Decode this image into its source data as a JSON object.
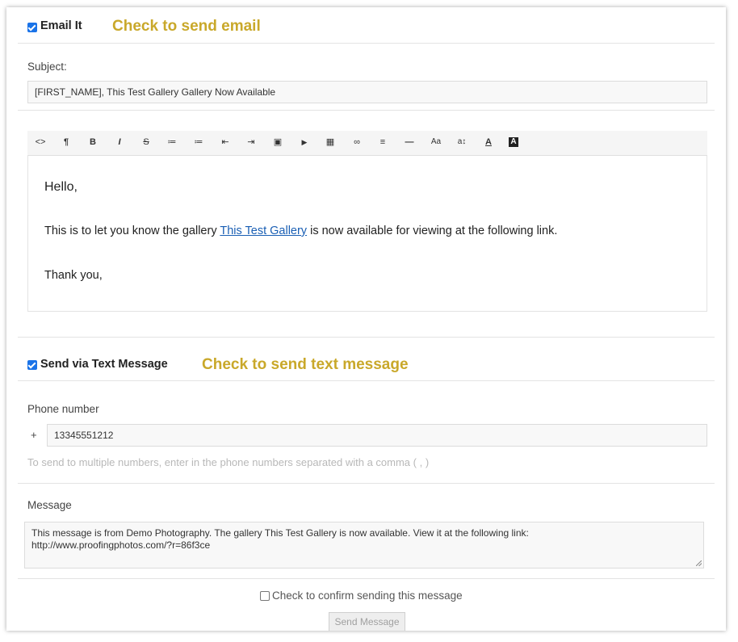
{
  "email": {
    "checkbox_label": "Email It",
    "checked": true,
    "hint": "Check to send email",
    "subject_label": "Subject:",
    "subject_value": "[FIRST_NAME], This Test Gallery Gallery Now Available",
    "toolbar": [
      {
        "icon": "code-view-icon",
        "glyph": "<>"
      },
      {
        "icon": "paragraph-icon",
        "glyph": "¶"
      },
      {
        "icon": "bold-icon",
        "glyph": "B"
      },
      {
        "icon": "italic-icon",
        "glyph": "I"
      },
      {
        "icon": "strikethrough-icon",
        "glyph": "S"
      },
      {
        "icon": "unordered-list-icon",
        "glyph": "≔"
      },
      {
        "icon": "ordered-list-icon",
        "glyph": "≔"
      },
      {
        "icon": "outdent-icon",
        "glyph": "⇤"
      },
      {
        "icon": "indent-icon",
        "glyph": "⇥"
      },
      {
        "icon": "image-icon",
        "glyph": "▣"
      },
      {
        "icon": "video-icon",
        "glyph": "▶"
      },
      {
        "icon": "table-icon",
        "glyph": "▦"
      },
      {
        "icon": "link-icon",
        "glyph": "∞"
      },
      {
        "icon": "align-icon",
        "glyph": "≡"
      },
      {
        "icon": "horizontal-rule-icon",
        "glyph": "—"
      },
      {
        "icon": "font-size-icon",
        "glyph": "Aa"
      },
      {
        "icon": "line-height-icon",
        "glyph": "a↕"
      },
      {
        "icon": "font-color-icon",
        "glyph": "A"
      },
      {
        "icon": "background-color-icon",
        "glyph": "A"
      }
    ],
    "body": {
      "greeting": "Hello,",
      "line_prefix": "This is to let you know the gallery ",
      "gallery_link": "This Test Gallery",
      "line_suffix": " is now available for viewing at the following link.",
      "closing": "Thank you,"
    }
  },
  "sms": {
    "checkbox_label": "Send via Text Message",
    "checked": true,
    "hint": "Check to send text message",
    "phone_label": "Phone number",
    "phone_prefix": "+",
    "phone_value": "13345551212",
    "phone_help": "To send to multiple numbers, enter in the phone numbers separated with a comma ( , )",
    "message_label": "Message",
    "message_line1": "This message is from Demo Photography. The gallery This Test Gallery is now available. View it at the following link:",
    "message_line2": "http://www.proofingphotos.com/?r=86f3ce"
  },
  "confirm": {
    "label": "Check to confirm sending this message",
    "checked": false
  },
  "send_button": "Send Message",
  "colors": {
    "hint": "#c9a82a",
    "checkbox": "#1a73e8",
    "link": "#1a5fb4"
  }
}
